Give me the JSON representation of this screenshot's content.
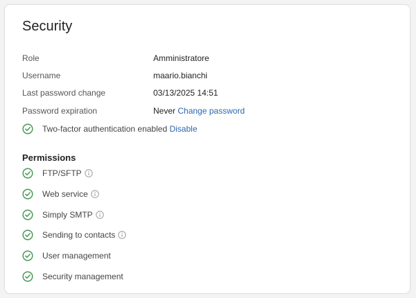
{
  "header": {
    "title": "Security"
  },
  "details": [
    {
      "label": "Role",
      "value": "Amministratore"
    },
    {
      "label": "Username",
      "value": "maario.bianchi"
    },
    {
      "label": "Last password change",
      "value": "03/13/2025 14:51"
    },
    {
      "label": "Password expiration",
      "value": "Never",
      "link": "Change password"
    }
  ],
  "two_factor": {
    "text": "Two-factor authentication enabled",
    "link": "Disable",
    "icon": "check-circle-icon"
  },
  "permissions": {
    "title": "Permissions",
    "items": [
      {
        "label": "FTP/SFTP",
        "info": true
      },
      {
        "label": "Web service",
        "info": true
      },
      {
        "label": "Simply SMTP",
        "info": true
      },
      {
        "label": "Sending to contacts",
        "info": true
      },
      {
        "label": "User management",
        "info": false
      },
      {
        "label": "Security management",
        "info": false
      }
    ]
  },
  "colors": {
    "check": "#4a9a56",
    "link": "#2a67b1",
    "info": "#9a9a9a"
  }
}
